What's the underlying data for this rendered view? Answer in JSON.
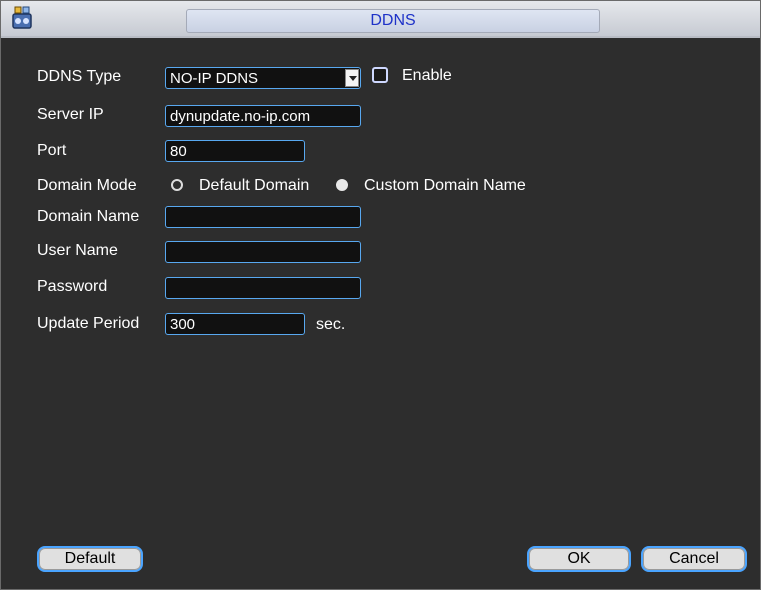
{
  "window": {
    "title": "DDNS",
    "icon": "app-icon"
  },
  "form": {
    "ddns_type": {
      "label": "DDNS Type",
      "value": "NO-IP DDNS",
      "options_visible": [
        "NO-IP DDNS"
      ]
    },
    "enable": {
      "label": "Enable",
      "checked": false
    },
    "server_ip": {
      "label": "Server IP",
      "value": "dynupdate.no-ip.com"
    },
    "port": {
      "label": "Port",
      "value": "80"
    },
    "domain_mode": {
      "label": "Domain Mode",
      "options": [
        {
          "label": "Default Domain",
          "selected": false
        },
        {
          "label": "Custom Domain Name",
          "selected": true
        }
      ]
    },
    "domain_name": {
      "label": "Domain Name",
      "value": ""
    },
    "user_name": {
      "label": "User Name",
      "value": ""
    },
    "password": {
      "label": "Password",
      "value": ""
    },
    "update_period": {
      "label": "Update Period",
      "value": "300",
      "unit": "sec."
    }
  },
  "buttons": {
    "default": "Default",
    "ok": "OK",
    "cancel": "Cancel"
  },
  "colors": {
    "background": "#2d2d2d",
    "field_border": "#58a8f0",
    "title_text": "#1e32c8"
  }
}
